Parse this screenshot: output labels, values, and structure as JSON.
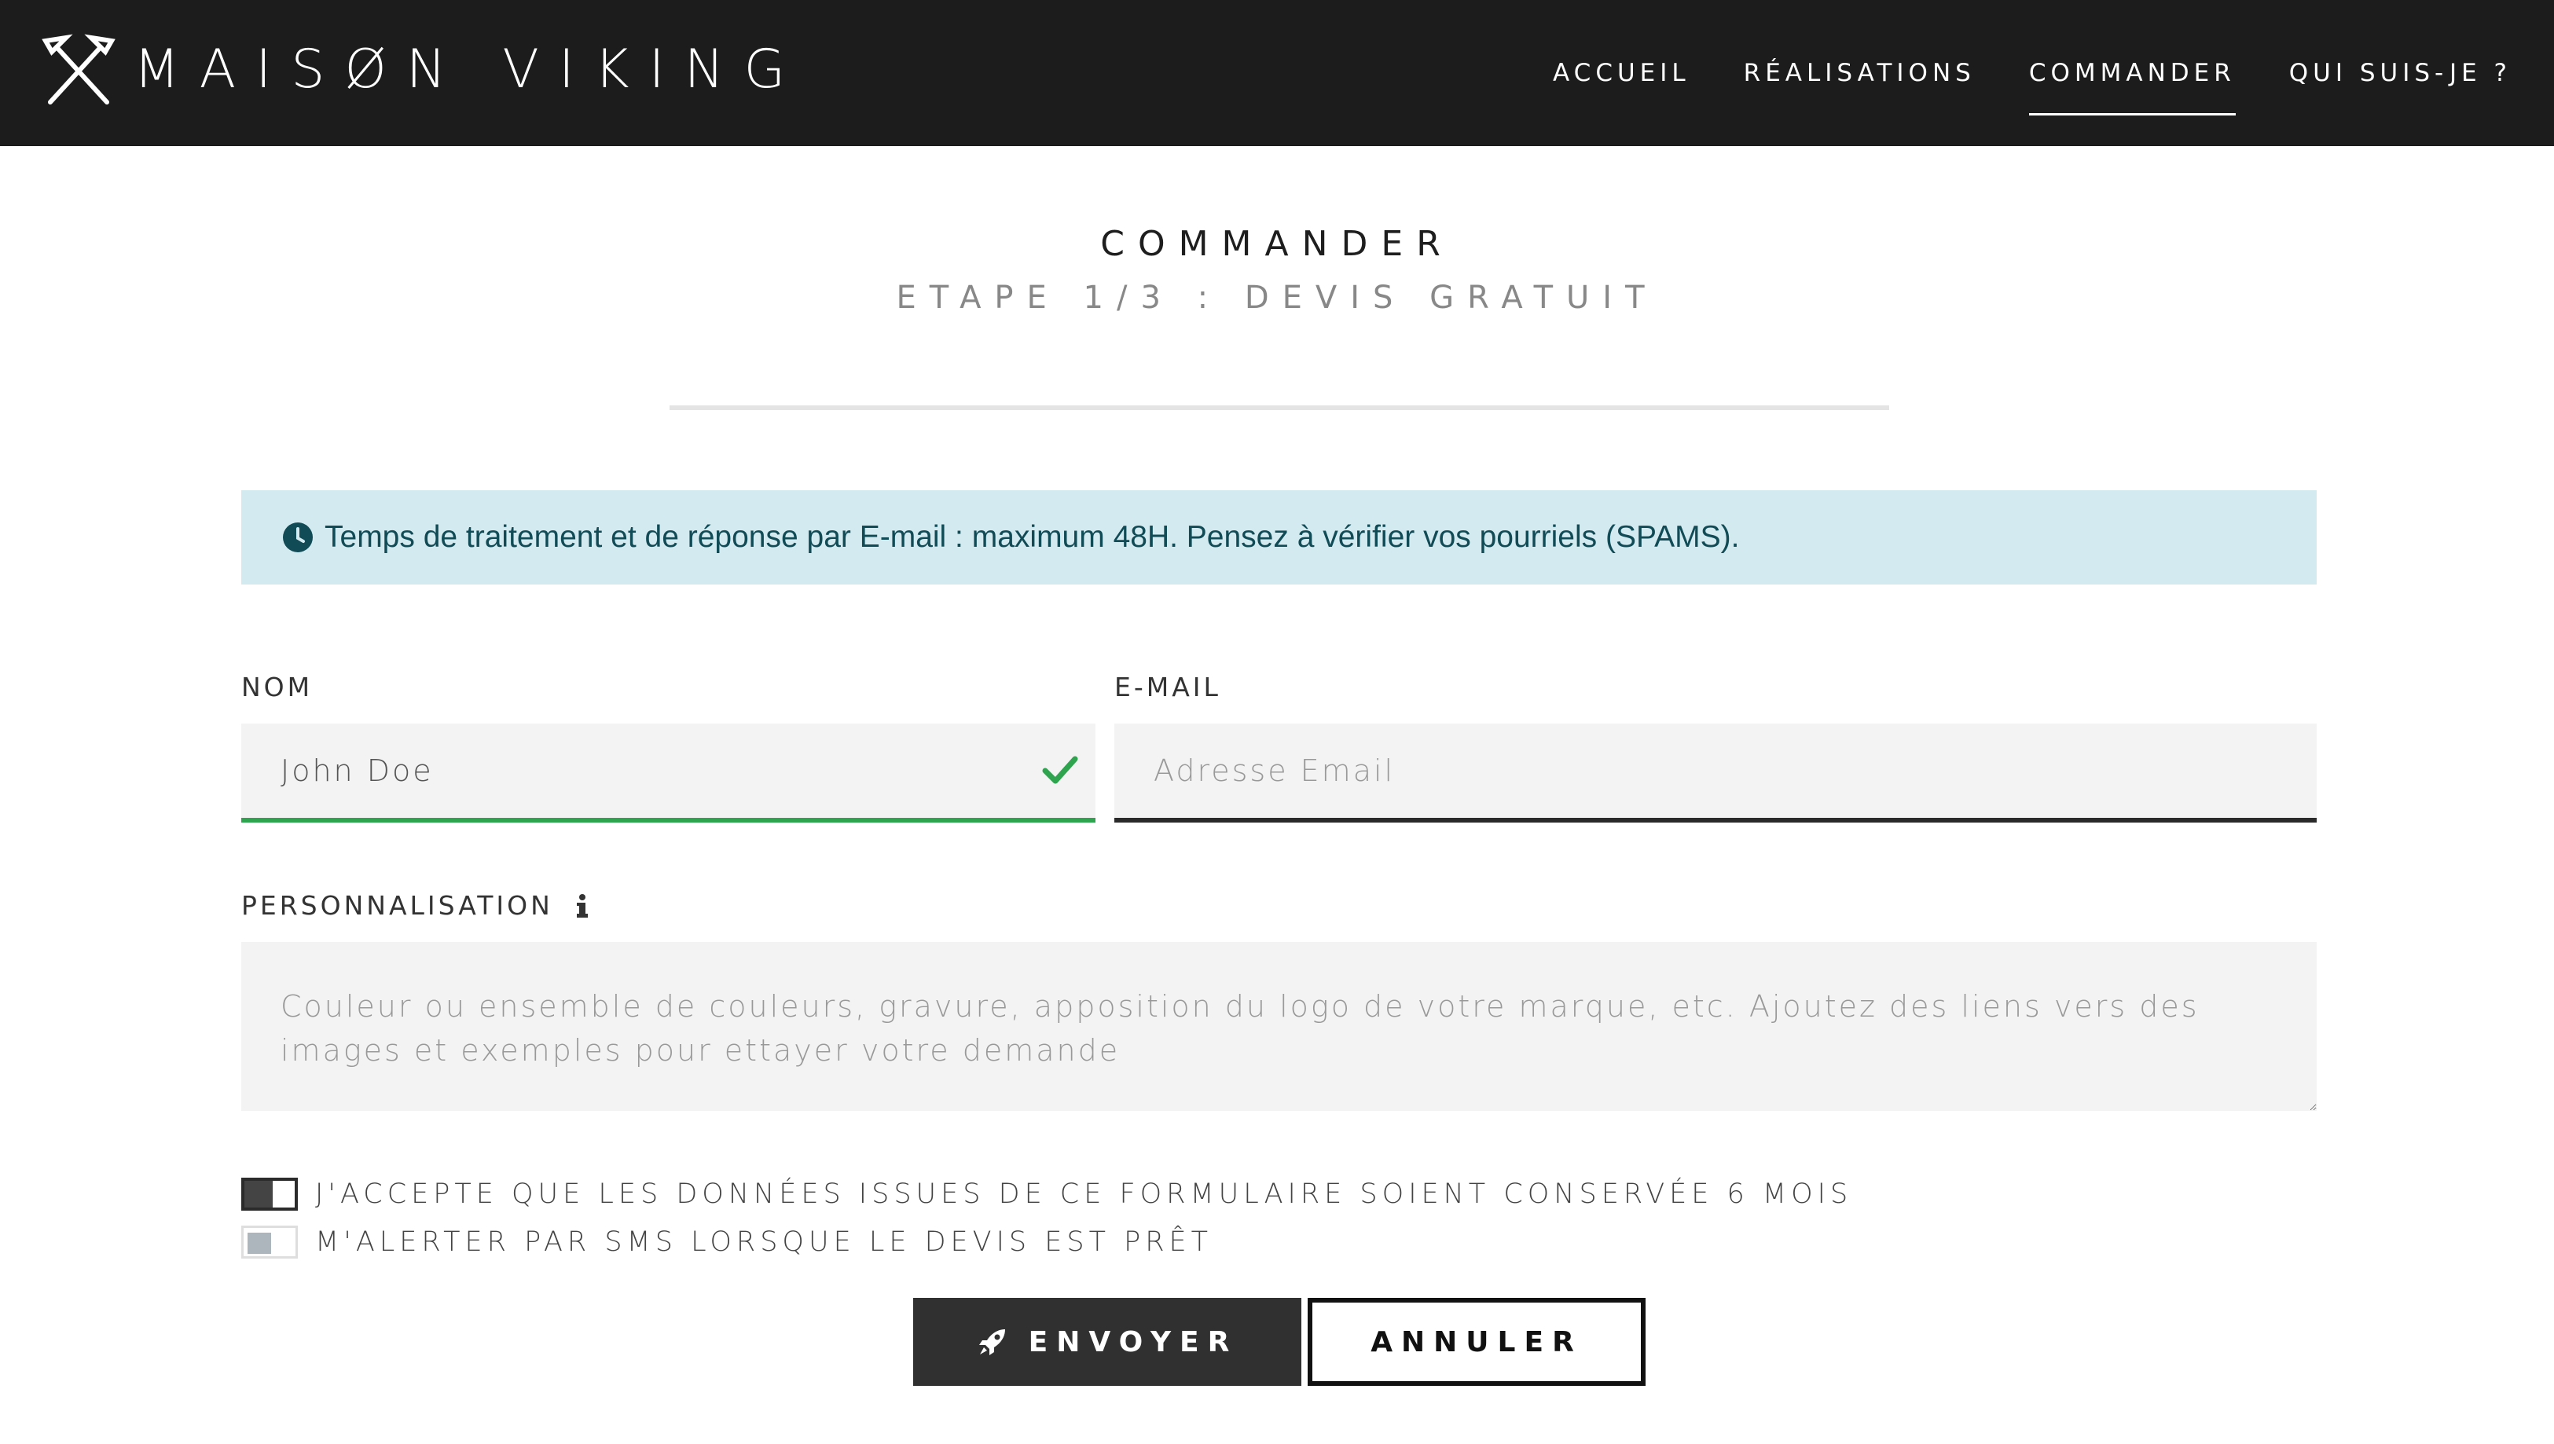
{
  "brand": {
    "name": "MAISØN VIKING",
    "logo_icon": "crossed-axes-icon"
  },
  "nav": {
    "items": [
      {
        "label": "ACCUEIL",
        "active": false
      },
      {
        "label": "RÉALISATIONS",
        "active": false
      },
      {
        "label": "COMMANDER",
        "active": true
      },
      {
        "label": "QUI SUIS-JE ?",
        "active": false
      }
    ]
  },
  "heading": {
    "title": "COMMANDER",
    "subtitle": "ETAPE 1/3 : DEVIS GRATUIT"
  },
  "alert": {
    "icon": "clock-icon",
    "text": "Temps de traitement et de réponse par E-mail : maximum 48H. Pensez à vérifier vos pourriels (SPAMS)."
  },
  "form": {
    "name": {
      "label": "NOM",
      "value": "John Doe",
      "placeholder": "",
      "valid": true
    },
    "email": {
      "label": "E-MAIL",
      "value": "",
      "placeholder": "Adresse Email"
    },
    "personalisation": {
      "label": "PERSONNALISATION",
      "info_icon": "info-icon",
      "value": "",
      "placeholder": "Couleur ou ensemble de couleurs, gravure, apposition du logo de votre marque, etc. Ajoutez des liens vers des images et exemples pour ettayer votre demande"
    },
    "toggles": [
      {
        "label": "J'ACCEPTE QUE LES DONNÉES ISSUES DE CE FORMULAIRE SOIENT CONSERVÉE 6 MOIS",
        "checked": true
      },
      {
        "label": "M'ALERTER PAR SMS LORSQUE LE DEVIS EST PRÊT",
        "checked": false
      }
    ],
    "buttons": {
      "send": "ENVOYER",
      "send_icon": "rocket-icon",
      "cancel": "ANNULER"
    }
  },
  "colors": {
    "navbar_bg": "#1c1c1c",
    "alert_bg": "#d3eaf0",
    "alert_text": "#114b56",
    "valid_green": "#2ea44f",
    "field_bg": "#f3f3f3",
    "button_dark": "#303030"
  }
}
